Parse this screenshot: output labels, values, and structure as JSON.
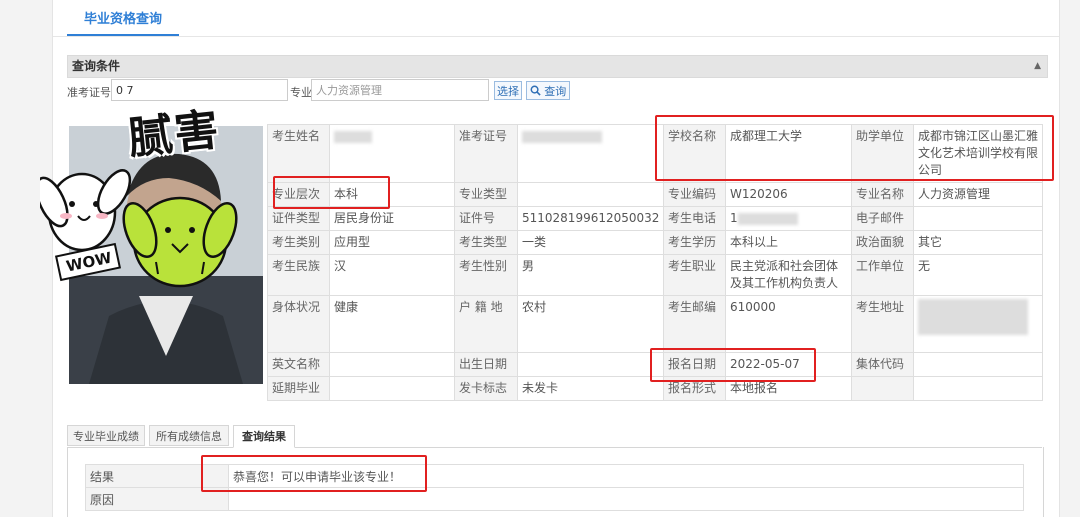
{
  "top_tab": "毕业资格查询",
  "conditions": {
    "header": "查询条件",
    "exam_no_label": "准考证号",
    "exam_no_value": "0                  7",
    "major_label": "专业",
    "major_placeholder": "人力资源管理",
    "select_btn": "选择",
    "query_btn": "查询"
  },
  "sticker": {
    "text": "腻害",
    "wow": "WOW"
  },
  "info": {
    "name_k": "考生姓名",
    "examno_k": "准考证号",
    "school_k": "学校名称",
    "school_v": "成都理工大学",
    "assist_k": "助学单位",
    "assist_v": "成都市锦江区山墨汇雅文化艺术培训学校有限公司",
    "level_k": "专业层次",
    "level_v": "本科",
    "mtype_k": "专业类型",
    "mcode_k": "专业编码",
    "mcode_v": "W120206",
    "mname_k": "专业名称",
    "mname_v": "人力资源管理",
    "idtype_k": "证件类型",
    "idtype_v": "居民身份证",
    "idno_k": "证件号",
    "idno_v": "511028199612050032",
    "phone_k": "考生电话",
    "phone_v": "1",
    "email_k": "电子邮件",
    "cat_k": "考生类别",
    "cat_v": "应用型",
    "type_k": "考生类型",
    "type_v": "一类",
    "edu_k": "考生学历",
    "edu_v": "本科以上",
    "pol_k": "政治面貌",
    "pol_v": "其它",
    "nation_k": "考生民族",
    "nation_v": "汉",
    "gender_k": "考生性别",
    "gender_v": "男",
    "job_k": "考生职业",
    "job_v": "民主党派和社会团体及其工作机构负责人",
    "work_k": "工作单位",
    "work_v": "无",
    "health_k": "身体状况",
    "health_v": "健康",
    "hukou_k": "户 籍 地",
    "hukou_v": "农村",
    "post_k": "考生邮编",
    "post_v": "610000",
    "addr_k": "考生地址",
    "en_k": "英文名称",
    "birth_k": "出生日期",
    "regdate_k": "报名日期",
    "regdate_v": "2022-05-07",
    "group_k": "集体代码",
    "delay_k": "延期毕业",
    "card_k": "发卡标志",
    "card_v": "未发卡",
    "regform_k": "报名形式",
    "regform_v": "本地报名"
  },
  "bottom_tabs": [
    "专业毕业成绩",
    "所有成绩信息",
    "查询结果"
  ],
  "result": {
    "result_k": "结果",
    "result_v": "恭喜您！可以申请毕业该专业！",
    "reason_k": "原因"
  }
}
